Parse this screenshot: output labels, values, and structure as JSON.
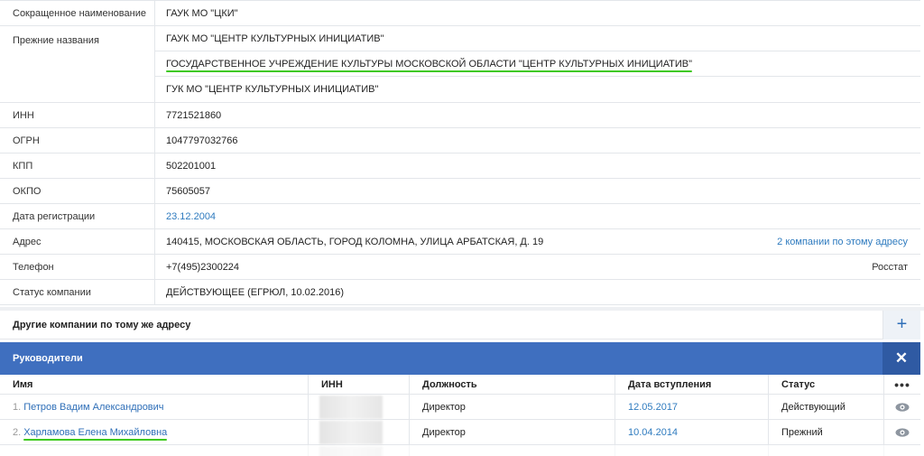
{
  "info": {
    "short_name_label": "Сокращенное наименование",
    "short_name_value": "ГАУК МО \"ЦКИ\"",
    "prev_names_label": "Прежние названия",
    "prev_names": [
      "ГАУК МО \"ЦЕНТР КУЛЬТУРНЫХ ИНИЦИАТИВ\"",
      "ГОСУДАРСТВЕННОЕ УЧРЕЖДЕНИЕ КУЛЬТУРЫ МОСКОВСКОЙ ОБЛАСТИ \"ЦЕНТР КУЛЬТУРНЫХ ИНИЦИАТИВ\"",
      "ГУК МО \"ЦЕНТР КУЛЬТУРНЫХ ИНИЦИАТИВ\""
    ],
    "inn_label": "ИНН",
    "inn_value": "7721521860",
    "ogrn_label": "ОГРН",
    "ogrn_value": "1047797032766",
    "kpp_label": "КПП",
    "kpp_value": "502201001",
    "okpo_label": "ОКПО",
    "okpo_value": "75605057",
    "reg_date_label": "Дата регистрации",
    "reg_date_value": "23.12.2004",
    "address_label": "Адрес",
    "address_value": "140415, МОСКОВСКАЯ ОБЛАСТЬ, ГОРОД КОЛОМНА, УЛИЦА АРБАТСКАЯ, Д. 19",
    "address_link": "2 компании по этому адресу",
    "phone_label": "Телефон",
    "phone_value": "+7(495)2300224",
    "phone_source": "Росстат",
    "status_label": "Статус компании",
    "status_value": "ДЕЙСТВУЮЩЕЕ (ЕГРЮЛ, 10.02.2016)"
  },
  "other_companies": {
    "title": "Другие компании по тому же адресу",
    "plus": "+"
  },
  "leaders": {
    "title": "Руководители",
    "close": "✕",
    "columns": {
      "name": "Имя",
      "inn": "ИНН",
      "position": "Должность",
      "date": "Дата вступления",
      "status": "Статус",
      "more": "•••"
    },
    "rows": [
      {
        "num": "1.",
        "name": "Петров Вадим Александрович",
        "position": "Директор",
        "date": "12.05.2017",
        "status": "Действующий"
      },
      {
        "num": "2.",
        "name": "Харламова Елена Михайловна",
        "position": "Директор",
        "date": "10.04.2014",
        "status": "Прежний"
      }
    ]
  },
  "colors": {
    "accent": "#3f6fbf",
    "link": "#2f7bbf",
    "highlight": "#3ec91c"
  }
}
